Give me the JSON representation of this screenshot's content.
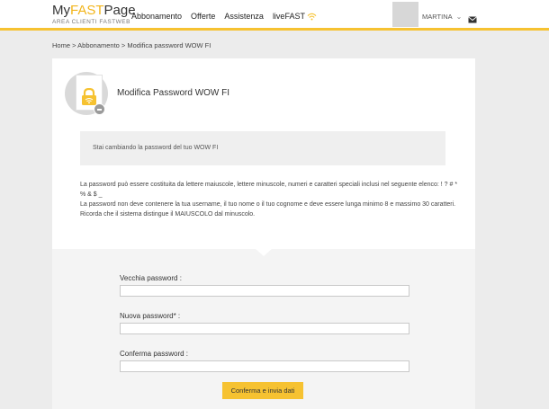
{
  "header": {
    "logo_part1": "My",
    "logo_highlight": "FAST",
    "logo_part2": "Page",
    "logo_sub": "AREA CLIENTI FASTWEB",
    "nav": [
      {
        "label": "Abbonamento"
      },
      {
        "label": "Offerte"
      },
      {
        "label": "Assistenza"
      },
      {
        "label": "liveFAST"
      }
    ],
    "user_name": "MARTINA",
    "accent_color": "#f6c231"
  },
  "breadcrumb": "Home > Abbonamento > Modifica password WOW FI",
  "card": {
    "title": "Modifica Password WOW FI",
    "info": "Stai cambiando la password del tuo WOW FI",
    "rules": [
      "La password può essere costituita da lettere maiuscole, lettere minuscole, numeri e caratteri speciali inclusi nel seguente elenco: ! ? # * % & $ _",
      "La password non deve contenere la tua username, il tuo nome o il tuo cognome e deve essere lunga minimo 8 e massimo 30 caratteri.",
      "Ricorda che il sistema distingue il MAIUSCOLO dal minuscolo."
    ]
  },
  "form": {
    "old_password_label": "Vecchia password :",
    "old_password_value": "",
    "new_password_label": "Nuova password* :",
    "new_password_value": "",
    "confirm_password_label": "Conferma password :",
    "confirm_password_value": "",
    "submit_label": "Conferma e invia dati"
  }
}
